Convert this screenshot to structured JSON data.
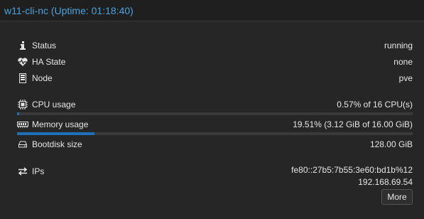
{
  "header": {
    "title": "w11-cli-nc (Uptime: 01:18:40)"
  },
  "status": [
    {
      "icon": "info-icon",
      "label": "Status",
      "value": "running"
    },
    {
      "icon": "heartbeat-icon",
      "label": "HA State",
      "value": "none"
    },
    {
      "icon": "server-icon",
      "label": "Node",
      "value": "pve"
    }
  ],
  "resources": {
    "cpu": {
      "icon": "cpu-icon",
      "label": "CPU usage",
      "value": "0.57% of 16 CPU(s)",
      "percent": 0.57
    },
    "memory": {
      "icon": "memory-icon",
      "label": "Memory usage",
      "value": "19.51% (3.12 GiB of 16.00 GiB)",
      "percent": 19.51
    },
    "bootdisk": {
      "icon": "hdd-icon",
      "label": "Bootdisk size",
      "value": "128.00 GiB"
    }
  },
  "network": {
    "icon": "exchange-icon",
    "label": "IPs",
    "ips": [
      "fe80::27b5:7b55:3e60:bd1b%12",
      "192.168.69.54"
    ],
    "more_label": "More"
  },
  "colors": {
    "accent": "#4aa3df",
    "bar_fill": "#1d6fb8",
    "bar_bg": "#3a3a3a",
    "background": "#262626"
  }
}
